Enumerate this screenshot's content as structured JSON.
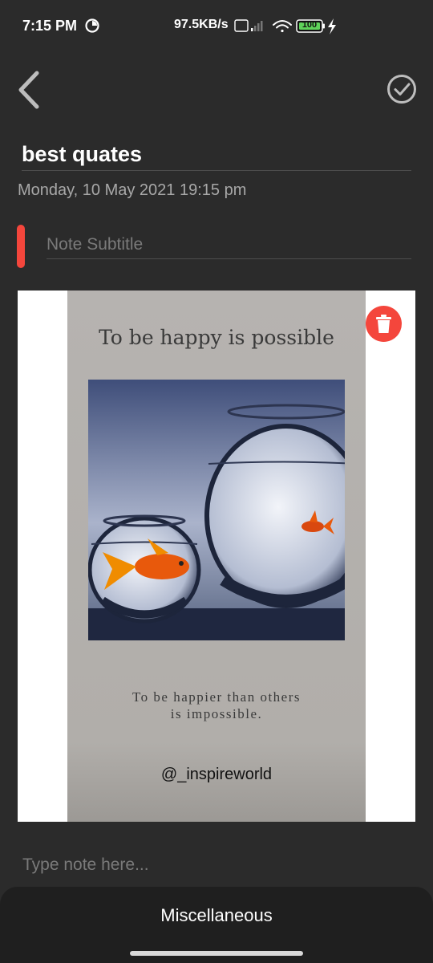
{
  "status_bar": {
    "time": "7:15 PM",
    "network_speed": "97.5KB/s",
    "battery": "100"
  },
  "toolbar": {
    "back_icon": "chevron-left-icon",
    "save_icon": "check-circle-icon"
  },
  "note": {
    "title": "best quates",
    "date_time": "Monday, 10 May 2021 19:15 pm",
    "subtitle_placeholder": "Note Subtitle",
    "subtitle_indicator_color": "#f4463c",
    "body_placeholder": "Type note here..."
  },
  "image": {
    "title": "To be happy is possible",
    "quote_line1": "To be happier than others",
    "quote_line2": "is impossible.",
    "handle": "@_inspireworld",
    "delete_icon": "trash-icon",
    "delete_color": "#f4463c"
  },
  "bottom_sheet": {
    "label": "Miscellaneous"
  }
}
